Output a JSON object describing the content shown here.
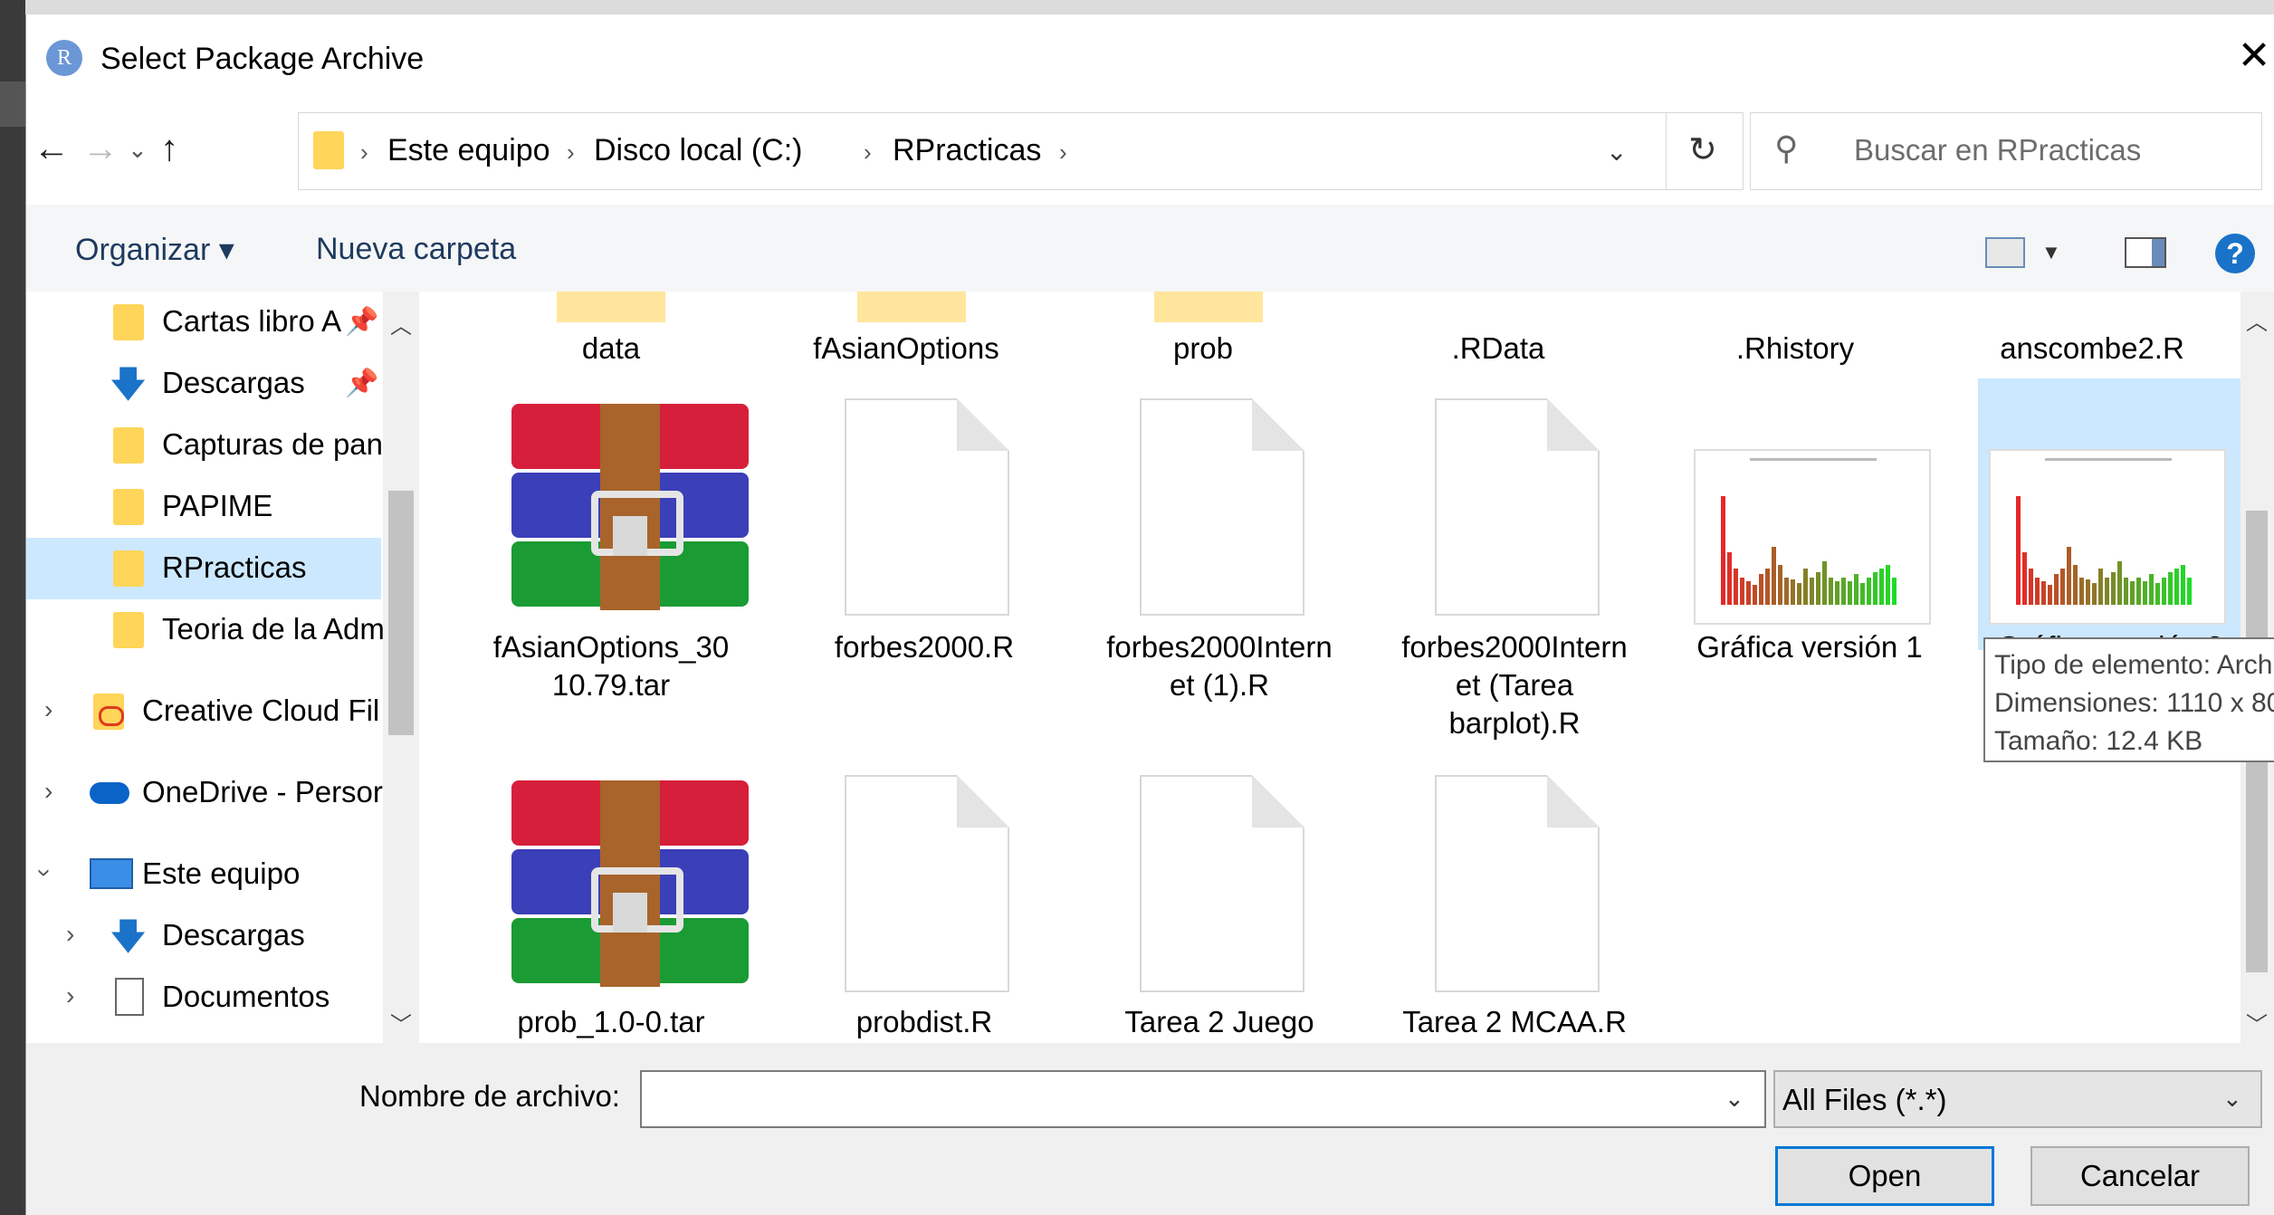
{
  "dialog": {
    "title": "Select Package Archive",
    "app_icon_letter": "R",
    "close_glyph": "✕"
  },
  "nav": {
    "back": "←",
    "forward": "→",
    "recent": "⌄",
    "up": "↑",
    "breadcrumb": [
      "Este equipo",
      "Disco local (C:)",
      "RPracticas"
    ],
    "refresh": "↻",
    "search_placeholder": "Buscar en RPracticas"
  },
  "toolbar": {
    "organize": "Organizar ▾",
    "new_folder": "Nueva carpeta",
    "help": "?"
  },
  "sidebar": {
    "items": [
      {
        "label": "Cartas libro A",
        "icon": "folder-icon",
        "pinned": true
      },
      {
        "label": "Descargas",
        "icon": "download-arrow-icon",
        "pinned": true
      },
      {
        "label": "Capturas de pan",
        "icon": "folder-icon"
      },
      {
        "label": "PAPIME",
        "icon": "folder-icon"
      },
      {
        "label": "RPracticas",
        "icon": "folder-icon",
        "selected": true
      },
      {
        "label": "Teoria de la Adm",
        "icon": "folder-icon"
      },
      {
        "label": "Creative Cloud Fil",
        "icon": "creative-cloud-icon"
      },
      {
        "label": "OneDrive - Persor",
        "icon": "onedrive-cloud-icon"
      },
      {
        "label": "Este equipo",
        "icon": "computer-icon"
      },
      {
        "label": "Descargas",
        "icon": "download-arrow-icon"
      },
      {
        "label": "Documentos",
        "icon": "documents-icon"
      }
    ]
  },
  "files": {
    "row0": [
      "data",
      "fAsianOptions",
      "prob",
      ".RData",
      ".Rhistory",
      "anscombe2.R"
    ],
    "row1": [
      "fAsianOptions_30\n10.79.tar",
      "forbes2000.R",
      "forbes2000Intern\net (1).R",
      "forbes2000Intern\net (Tarea\nbarplot).R",
      "Gráfica versión 1",
      "Gráfica versión 2"
    ],
    "row2": [
      "prob_1.0-0.tar",
      "probdist.R",
      "Tarea 2 Juego",
      "Tarea 2 MCAA.R"
    ]
  },
  "tooltip": {
    "type": "Tipo de elemento: Arch",
    "dimensions": "Dimensiones: 1110 x 80",
    "size": "Tamaño: 12.4 KB"
  },
  "bottom": {
    "filename_label": "Nombre de archivo:",
    "filename_value": "",
    "filter_value": "All Files (*.*)",
    "open_label": "Open",
    "cancel_label": "Cancelar"
  }
}
